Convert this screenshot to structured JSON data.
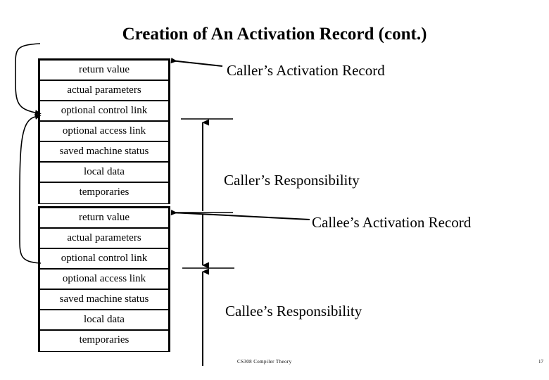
{
  "slide": {
    "title": "Creation of An Activation Record (cont.)",
    "background_color": "#ffffff",
    "ink_color": "#000000"
  },
  "caller_record": {
    "name": "Caller's Activation Record",
    "rows": [
      "return value",
      "actual parameters",
      "optional control link",
      "optional access link",
      "saved machine status",
      "local data",
      "temporaries"
    ]
  },
  "callee_record": {
    "name": "Callee's Activation Record",
    "rows": [
      "return value",
      "actual parameters",
      "optional control link",
      "optional access link",
      "saved machine status",
      "local data",
      "temporaries"
    ]
  },
  "labels": {
    "caller_activation_record": "Caller’s Activation Record",
    "caller_responsibility": "Caller’s Responsibility",
    "callee_activation_record": "Callee’s Activation Record",
    "callee_responsibility": "Callee’s Responsibility"
  },
  "footer": {
    "course": "CS308  Compiler Theory",
    "page_number": "17"
  }
}
